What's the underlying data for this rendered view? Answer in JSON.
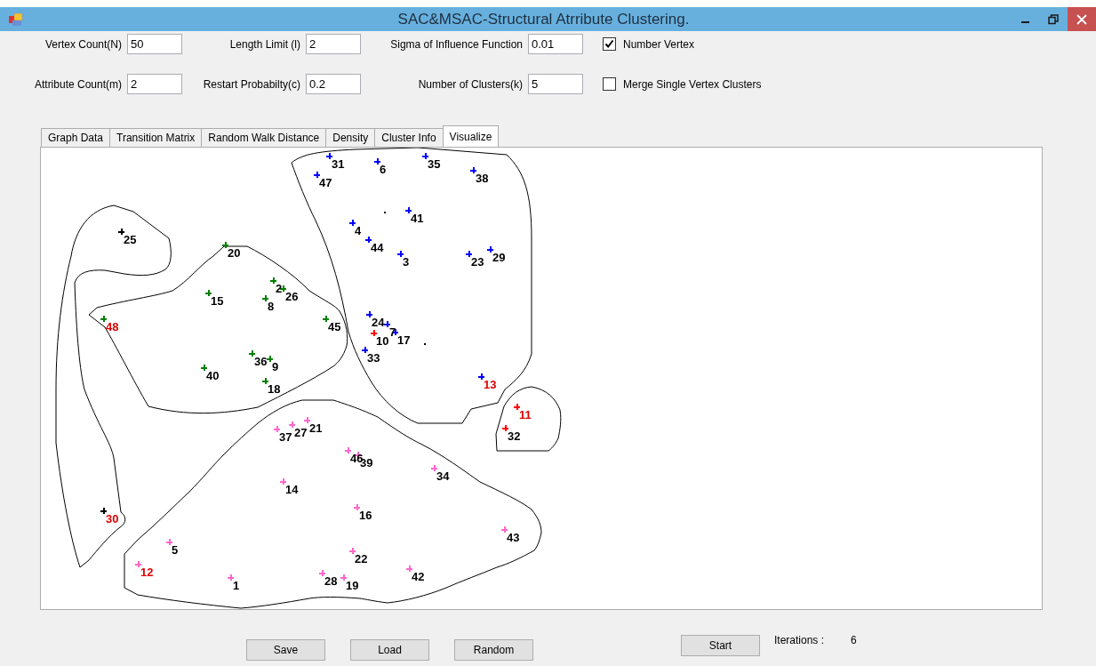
{
  "window": {
    "title": "SAC&MSAC-Structural Atrribute Clustering."
  },
  "fields": [
    {
      "label": "Vertex Count(N)",
      "value": "50"
    },
    {
      "label": "Length Limit (l)",
      "value": "2"
    },
    {
      "label": "Sigma of Influence Function",
      "value": "0.01"
    },
    {
      "label": "Attribute Count(m)",
      "value": "2"
    },
    {
      "label": "Restart Probabilty(c)",
      "value": "0.2"
    },
    {
      "label": "Number of Clusters(k)",
      "value": "5"
    }
  ],
  "checkboxes": [
    {
      "label": "Number Vertex",
      "checked": true
    },
    {
      "label": "Merge Single Vertex Clusters",
      "checked": false
    }
  ],
  "tabs": [
    {
      "label": "Graph Data",
      "selected": false
    },
    {
      "label": "Transition Matrix",
      "selected": false
    },
    {
      "label": "Random Walk Distance",
      "selected": false
    },
    {
      "label": "Density",
      "selected": false
    },
    {
      "label": "Cluster Info",
      "selected": false
    },
    {
      "label": "Visualize",
      "selected": true
    }
  ],
  "vertices": [
    {
      "label": "31",
      "color": "#0000ff",
      "outlier": false
    },
    {
      "label": "6",
      "color": "#0000ff",
      "outlier": false
    },
    {
      "label": "35",
      "color": "#0000ff",
      "outlier": false
    },
    {
      "label": "38",
      "color": "#0000ff",
      "outlier": false
    },
    {
      "label": "47",
      "color": "#0000ff",
      "outlier": false
    },
    {
      "label": "41",
      "color": "#0000ff",
      "outlier": false
    },
    {
      "label": "4",
      "color": "#0000ff",
      "outlier": false
    },
    {
      "label": "44",
      "color": "#0000ff",
      "outlier": false
    },
    {
      "label": "3",
      "color": "#0000ff",
      "outlier": false
    },
    {
      "label": "23",
      "color": "#0000ff",
      "outlier": false
    },
    {
      "label": "29",
      "color": "#0000ff",
      "outlier": false
    },
    {
      "label": "24",
      "color": "#0000ff",
      "outlier": false
    },
    {
      "label": "7",
      "color": "#0000ff",
      "outlier": false
    },
    {
      "label": "17",
      "color": "#0000ff",
      "outlier": false
    },
    {
      "label": "10",
      "color": "#ff0000",
      "outlier": false
    },
    {
      "label": "33",
      "color": "#0000ff",
      "outlier": false
    },
    {
      "label": "13",
      "color": "#0000ff",
      "outlier": true
    },
    {
      "label": "25",
      "color": "#000000",
      "outlier": false
    },
    {
      "label": "20",
      "color": "#008000",
      "outlier": false
    },
    {
      "label": "2",
      "color": "#008000",
      "outlier": false
    },
    {
      "label": "26",
      "color": "#008000",
      "outlier": false
    },
    {
      "label": "15",
      "color": "#008000",
      "outlier": false
    },
    {
      "label": "8",
      "color": "#008000",
      "outlier": false
    },
    {
      "label": "48",
      "color": "#008000",
      "outlier": true
    },
    {
      "label": "45",
      "color": "#008000",
      "outlier": false
    },
    {
      "label": "36",
      "color": "#008000",
      "outlier": false
    },
    {
      "label": "9",
      "color": "#008000",
      "outlier": false
    },
    {
      "label": "40",
      "color": "#008000",
      "outlier": false
    },
    {
      "label": "18",
      "color": "#008000",
      "outlier": false
    },
    {
      "label": "11",
      "color": "#ff0000",
      "outlier": true
    },
    {
      "label": "37",
      "color": "#ff66cc",
      "outlier": false
    },
    {
      "label": "27",
      "color": "#ff66cc",
      "outlier": false
    },
    {
      "label": "21",
      "color": "#ff66cc",
      "outlier": false
    },
    {
      "label": "32",
      "color": "#ff0000",
      "outlier": false
    },
    {
      "label": "46",
      "color": "#ff66cc",
      "outlier": false
    },
    {
      "label": "39",
      "color": "#ff66cc",
      "outlier": false
    },
    {
      "label": "34",
      "color": "#ff66cc",
      "outlier": false
    },
    {
      "label": "14",
      "color": "#ff66cc",
      "outlier": false
    },
    {
      "label": "16",
      "color": "#ff66cc",
      "outlier": false
    },
    {
      "label": "30",
      "color": "#000000",
      "outlier": true
    },
    {
      "label": "43",
      "color": "#ff66cc",
      "outlier": false
    },
    {
      "label": "5",
      "color": "#ff66cc",
      "outlier": false
    },
    {
      "label": "22",
      "color": "#ff66cc",
      "outlier": false
    },
    {
      "label": "12",
      "color": "#ff66cc",
      "outlier": true
    },
    {
      "label": "42",
      "color": "#ff66cc",
      "outlier": false
    },
    {
      "label": "1",
      "color": "#ff66cc",
      "outlier": false
    },
    {
      "label": "28",
      "color": "#ff66cc",
      "outlier": false
    },
    {
      "label": "19",
      "color": "#ff66cc",
      "outlier": false
    }
  ],
  "buttons": [
    {
      "label": "Save"
    },
    {
      "label": "Load"
    },
    {
      "label": "Random"
    }
  ],
  "start_button": {
    "label": "Start"
  },
  "iterations": {
    "label": "Iterations :",
    "value": "6"
  }
}
